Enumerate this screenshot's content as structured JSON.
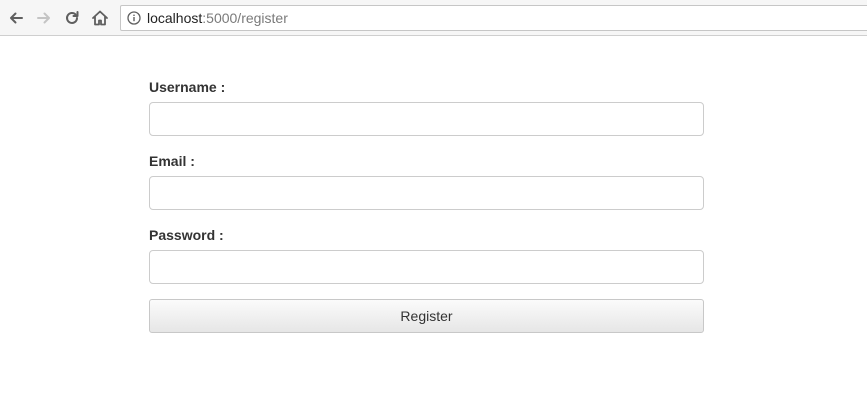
{
  "browser": {
    "url_host": "localhost",
    "url_path": ":5000/register",
    "icons": {
      "back": "back-arrow-icon",
      "forward": "forward-arrow-icon",
      "reload": "reload-icon",
      "home": "home-icon",
      "info": "info-icon"
    }
  },
  "form": {
    "username": {
      "label": "Username :",
      "value": "",
      "placeholder": ""
    },
    "email": {
      "label": "Email :",
      "value": "",
      "placeholder": ""
    },
    "password": {
      "label": "Password :",
      "value": "",
      "placeholder": ""
    },
    "submit_label": "Register"
  },
  "colors": {
    "label_text": "#333333",
    "input_border": "#cccccc",
    "button_border": "#c8c8c8"
  }
}
